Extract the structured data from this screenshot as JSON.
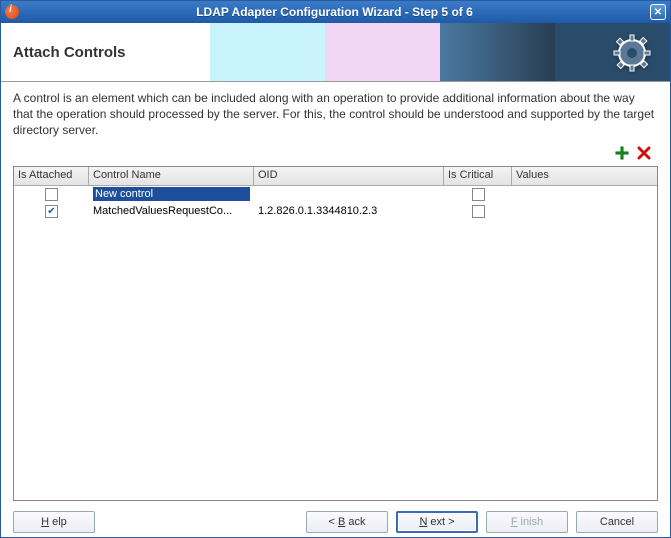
{
  "window": {
    "title": "LDAP Adapter Configuration Wizard - Step 5 of 6"
  },
  "banner": {
    "title": "Attach Controls"
  },
  "description": "A control is an element which can be included along with an operation to provide additional information about the way that the operation should processed by the server. For this, the control should be understood and supported by the target directory server.",
  "toolbar": {
    "add_tooltip": "Add",
    "remove_tooltip": "Remove"
  },
  "table": {
    "headers": {
      "is_attached": "Is Attached",
      "control_name": "Control Name",
      "oid": "OID",
      "is_critical": "Is Critical",
      "values": "Values"
    },
    "rows": [
      {
        "attached": false,
        "name": "New control",
        "name_selected": true,
        "oid": "",
        "critical": false,
        "values": ""
      },
      {
        "attached": true,
        "name": "MatchedValuesRequestCo...",
        "name_selected": false,
        "oid": "1.2.826.0.1.3344810.2.3",
        "critical": false,
        "values": ""
      }
    ]
  },
  "footer": {
    "help": "Help",
    "back": "< Back",
    "next": "Next >",
    "finish": "Finish",
    "cancel": "Cancel"
  }
}
